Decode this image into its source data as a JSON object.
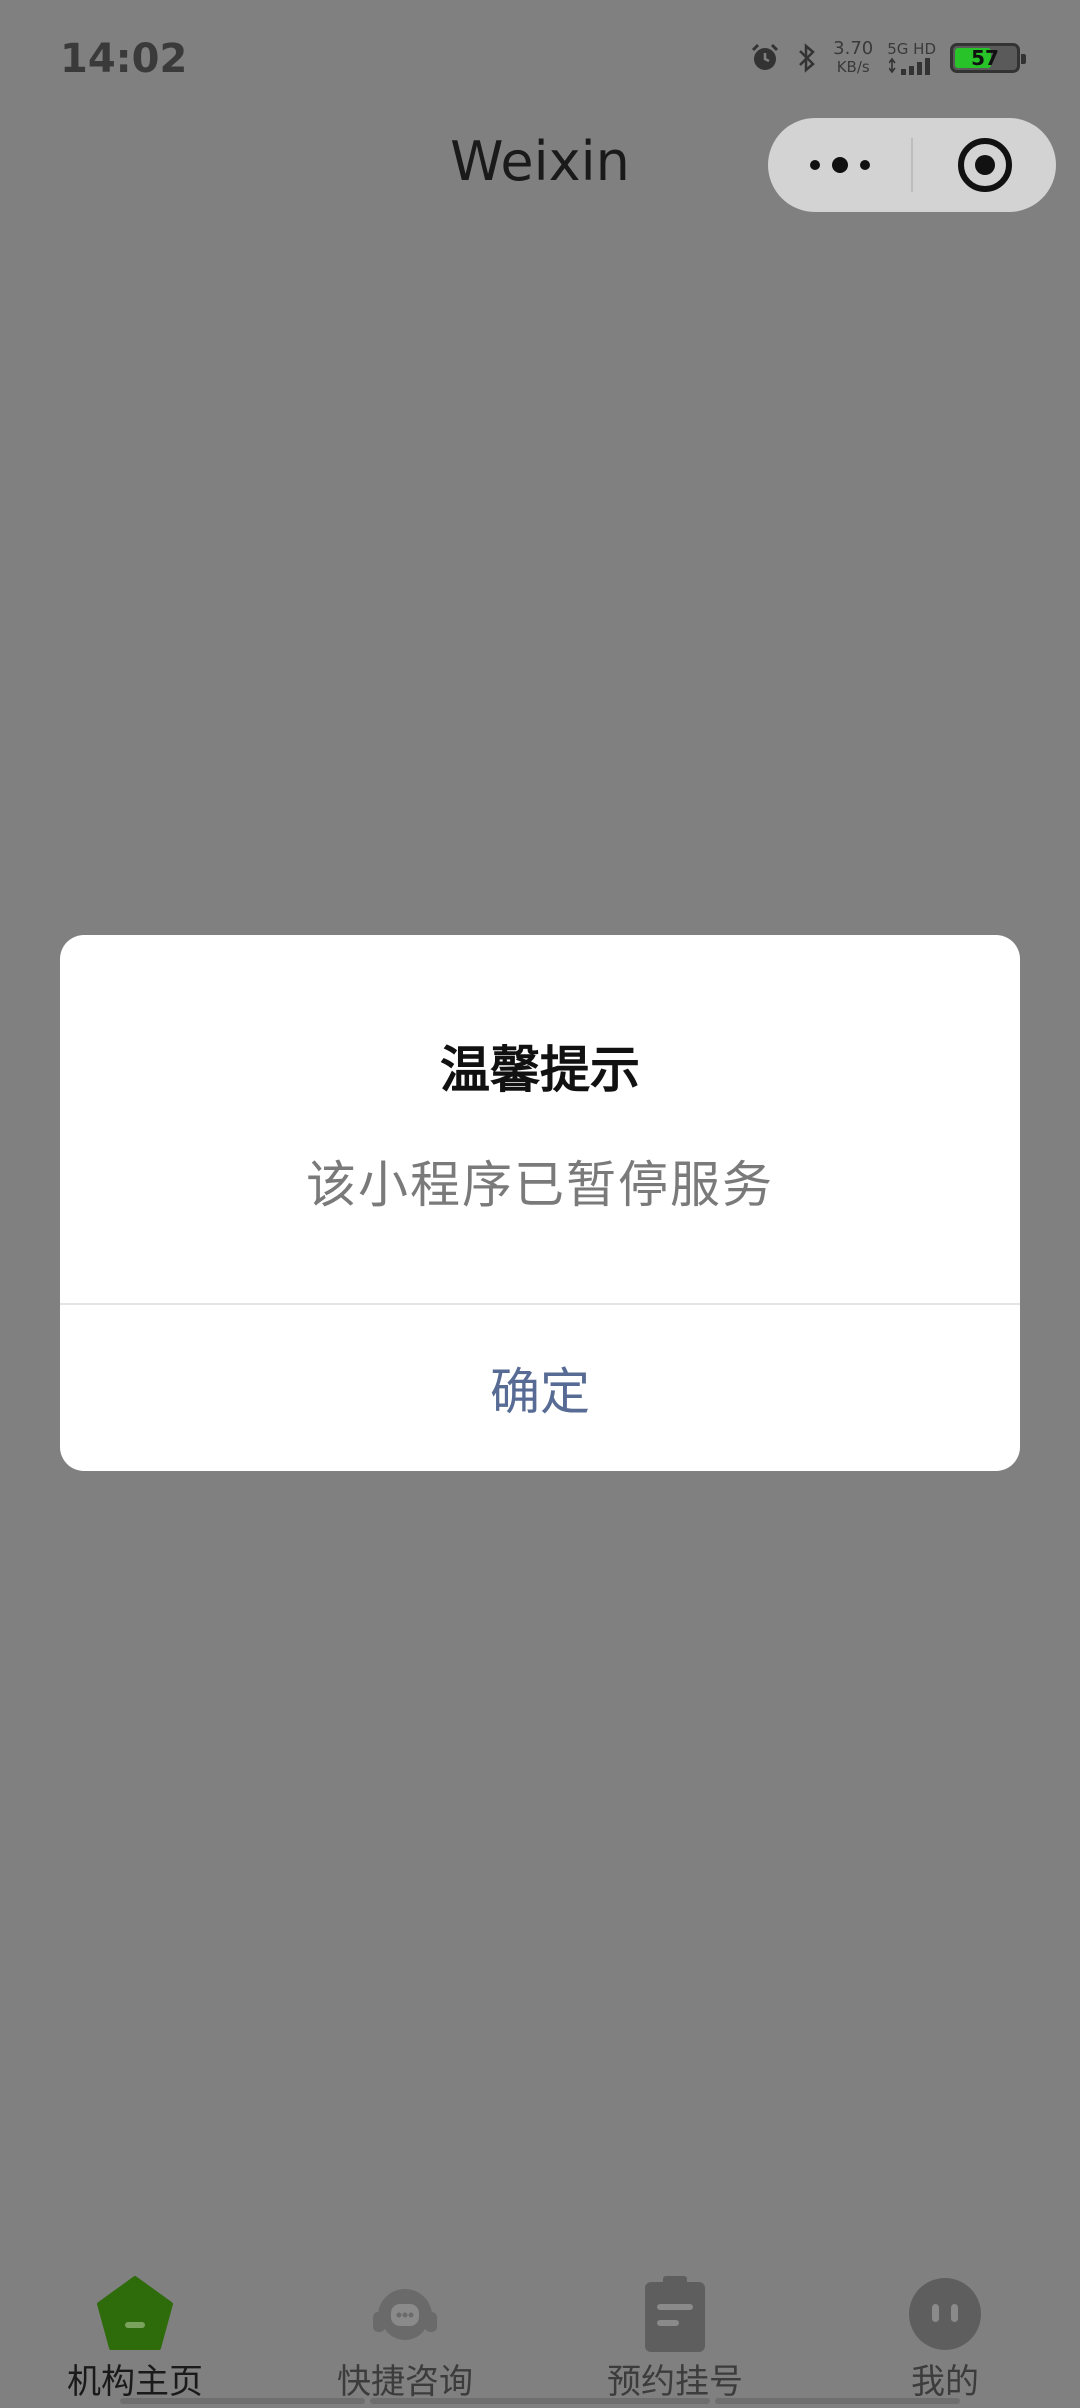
{
  "status_bar": {
    "time": "14:02",
    "speed_value": "3.70",
    "speed_unit": "KB/s",
    "network": "5G HD",
    "battery": "57"
  },
  "nav": {
    "title": "Weixin"
  },
  "dialog": {
    "title": "温馨提示",
    "content": "该小程序已暂停服务",
    "confirm": "确定"
  },
  "tabbar": {
    "items": [
      {
        "label": "机构主页",
        "icon": "home-icon",
        "active": true
      },
      {
        "label": "快捷咨询",
        "icon": "chat-icon",
        "active": false
      },
      {
        "label": "预约挂号",
        "icon": "clipboard-icon",
        "active": false
      },
      {
        "label": "我的",
        "icon": "profile-icon",
        "active": false
      }
    ]
  },
  "colors": {
    "overlay": "#808080",
    "dialog_button": "#576b95",
    "active_tab": "#2e6b0a",
    "battery": "#28c328"
  }
}
